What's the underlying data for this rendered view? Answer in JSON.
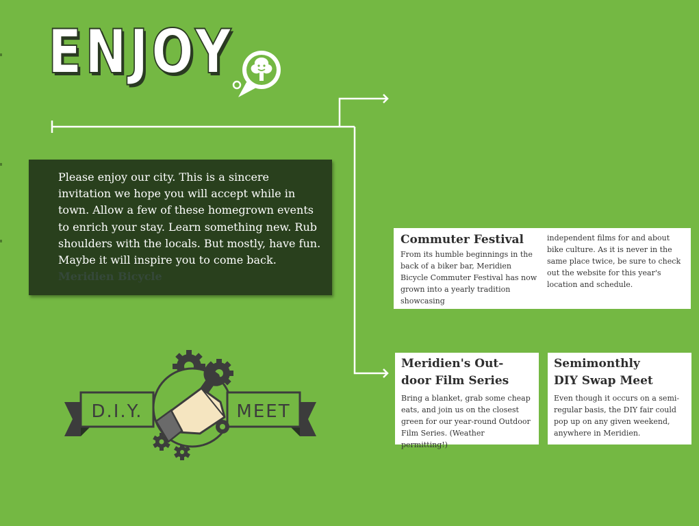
{
  "header": {
    "title": "ENJOY"
  },
  "intro": {
    "body": "Please enjoy our city. This is a sincere invitation we hope you will accept while in town. Allow a few of these homegrown events to enrich your stay. Learn something new. Rub shoulders with the locals. But mostly, have fun. Maybe it will inspire you to come back.",
    "faded": "Meridien Bicycle"
  },
  "cards": {
    "commuter": {
      "title": "Commuter Festival",
      "col1": "From its humble beginnings in the back of a biker bar, Meridien Bicycle Commuter Festival has now grown into a yearly tradition showcasing",
      "col2": "independent films for and about bike culture. As it is never in the same place twice, be sure to check out the website for this year's location and schedule."
    },
    "film": {
      "title_line1": "Meridien's Out-",
      "title_line2": "door Film Series",
      "body": "Bring a blanket, grab some cheap eats, and join us on the closest green for our year-round Outdoor Film Series. (Weather permitting!)"
    },
    "swap": {
      "title_line1": "Semimonthly",
      "title_line2": "DIY Swap Meet",
      "body": "Even though it occurs on a semi-regular basis, the DIY fair could pop up on any given weekend, anywhere in Meridien."
    }
  },
  "badge": {
    "left": "D.I.Y.",
    "right": "MEET"
  },
  "icons": {
    "logo": "tree-speech-bubble-icon",
    "badge": "wrench-gears-icon"
  },
  "colors": {
    "background": "#74b843",
    "dark_box": "#29401d",
    "ink": "#3c3c3c",
    "skin": "#f5e5c0"
  }
}
